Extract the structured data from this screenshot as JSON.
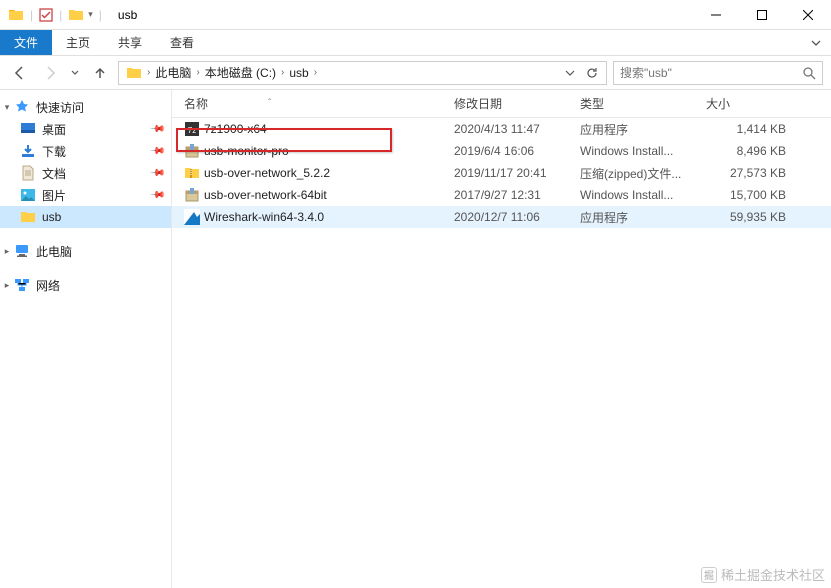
{
  "window": {
    "title": "usb"
  },
  "ribbon": {
    "file": "文件",
    "tabs": [
      "主页",
      "共享",
      "查看"
    ]
  },
  "nav": {
    "breadcrumbs": [
      {
        "label": "此电脑"
      },
      {
        "label": "本地磁盘 (C:)"
      },
      {
        "label": "usb"
      }
    ]
  },
  "search": {
    "placeholder": "搜索\"usb\""
  },
  "sidebar": {
    "quick_access": "快速访问",
    "items": [
      {
        "label": "桌面",
        "icon": "desktop"
      },
      {
        "label": "下载",
        "icon": "download"
      },
      {
        "label": "文档",
        "icon": "document"
      },
      {
        "label": "图片",
        "icon": "picture"
      },
      {
        "label": "usb",
        "icon": "folder",
        "selected": true
      }
    ],
    "this_pc": "此电脑",
    "network": "网络"
  },
  "columns": {
    "name": "名称",
    "date": "修改日期",
    "type": "类型",
    "size": "大小"
  },
  "files": [
    {
      "name": "7z1900-x64",
      "date": "2020/4/13 11:47",
      "type": "应用程序",
      "size": "1,414 KB",
      "icon": "7z"
    },
    {
      "name": "usb-monitor-pro",
      "date": "2019/6/4 16:06",
      "type": "Windows Install...",
      "size": "8,496 KB",
      "icon": "msi"
    },
    {
      "name": "usb-over-network_5.2.2",
      "date": "2019/11/17 20:41",
      "type": "压缩(zipped)文件...",
      "size": "27,573 KB",
      "icon": "zip"
    },
    {
      "name": "usb-over-network-64bit",
      "date": "2017/9/27 12:31",
      "type": "Windows Install...",
      "size": "15,700 KB",
      "icon": "msi"
    },
    {
      "name": "Wireshark-win64-3.4.0",
      "date": "2020/12/7 11:06",
      "type": "应用程序",
      "size": "59,935 KB",
      "icon": "ws",
      "hover": true
    }
  ],
  "highlight": {
    "row_index": 1
  },
  "watermark": "稀土掘金技术社区"
}
